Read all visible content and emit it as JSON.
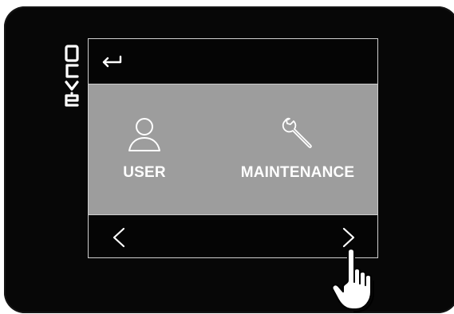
{
  "brand": {
    "logo_text": "EVCO",
    "logo_icon": "evco-logo"
  },
  "screen": {
    "back_icon": "return-arrow-icon",
    "menu_items": [
      {
        "label": "USER",
        "icon": "user-icon"
      },
      {
        "label": "MAINTENANCE",
        "icon": "wrench-icon"
      }
    ],
    "nav": {
      "prev_icon": "chevron-left-icon",
      "next_icon": "chevron-right-icon"
    }
  },
  "pointer": {
    "icon": "hand-pointer-icon"
  },
  "colors": {
    "device_background": "#070707",
    "menu_background": "#9d9d9d",
    "screen_border": "#cfcfcf",
    "text": "#ffffff"
  }
}
